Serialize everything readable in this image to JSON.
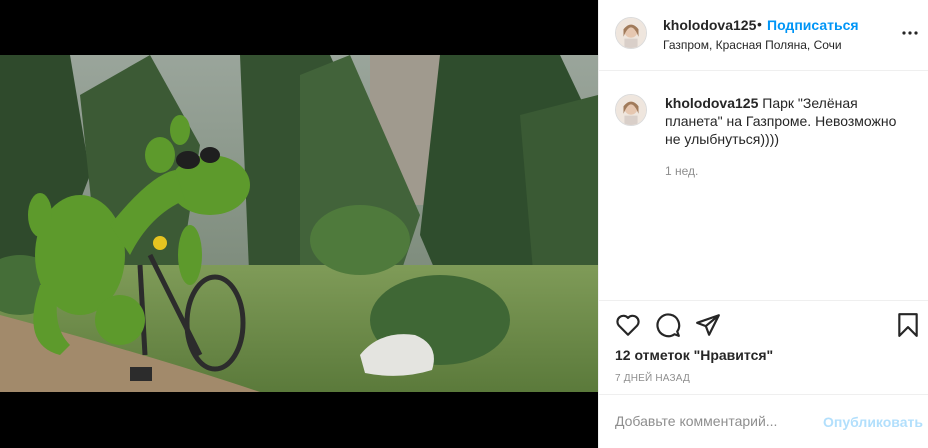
{
  "post": {
    "username": "kholodova125",
    "separator": "•",
    "follow_label": "Подписаться",
    "location": "Газпром, Красная Поляна, Сочи",
    "photo_alt": "Топиарная фигура зелёного верблюда на велосипеде среди елей"
  },
  "comment": {
    "username": "kholodova125",
    "text": "Парк \"Зелёная планета\" на Газпроме. Невозможно не улыбнуться))))",
    "age": "1 нед."
  },
  "actions": {
    "likes": "12 отметок \"Нравится\"",
    "date": "7 дней назад"
  },
  "add_comment": {
    "placeholder": "Добавьте комментарий...",
    "publish_label": "Опубликовать"
  },
  "icons": [
    "more-options-icon",
    "heart-icon",
    "comment-icon",
    "share-icon",
    "save-icon"
  ],
  "colors": {
    "link": "#0095f6",
    "muted": "#8e8e8e",
    "publish_disabled": "#b2dffc"
  }
}
